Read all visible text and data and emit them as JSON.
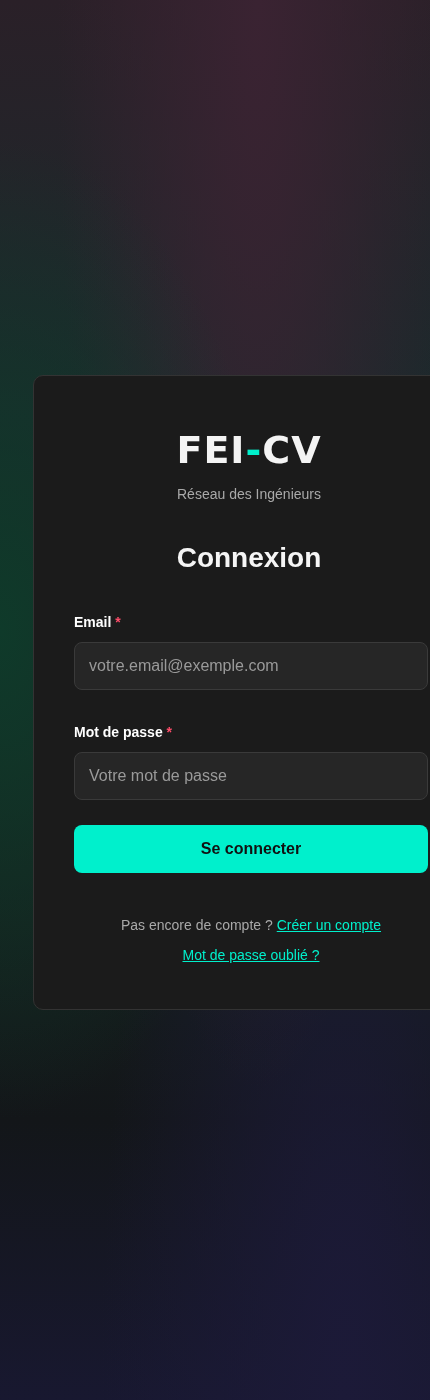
{
  "logo": {
    "before": "FEI",
    "accent": "-",
    "after": "CV"
  },
  "tagline": "Réseau des Ingénieurs",
  "title": "Connexion",
  "fields": [
    {
      "label": "Email",
      "required_mark": "*",
      "placeholder": "votre.email@exemple.com"
    },
    {
      "label": "Mot de passe",
      "required_mark": "*",
      "placeholder": "Votre mot de passe"
    }
  ],
  "submit": "Se connecter",
  "signup": {
    "text": "Pas encore de compte ?",
    "link": "Créer un compte"
  },
  "forgot_link": "Mot de passe oublié ?"
}
